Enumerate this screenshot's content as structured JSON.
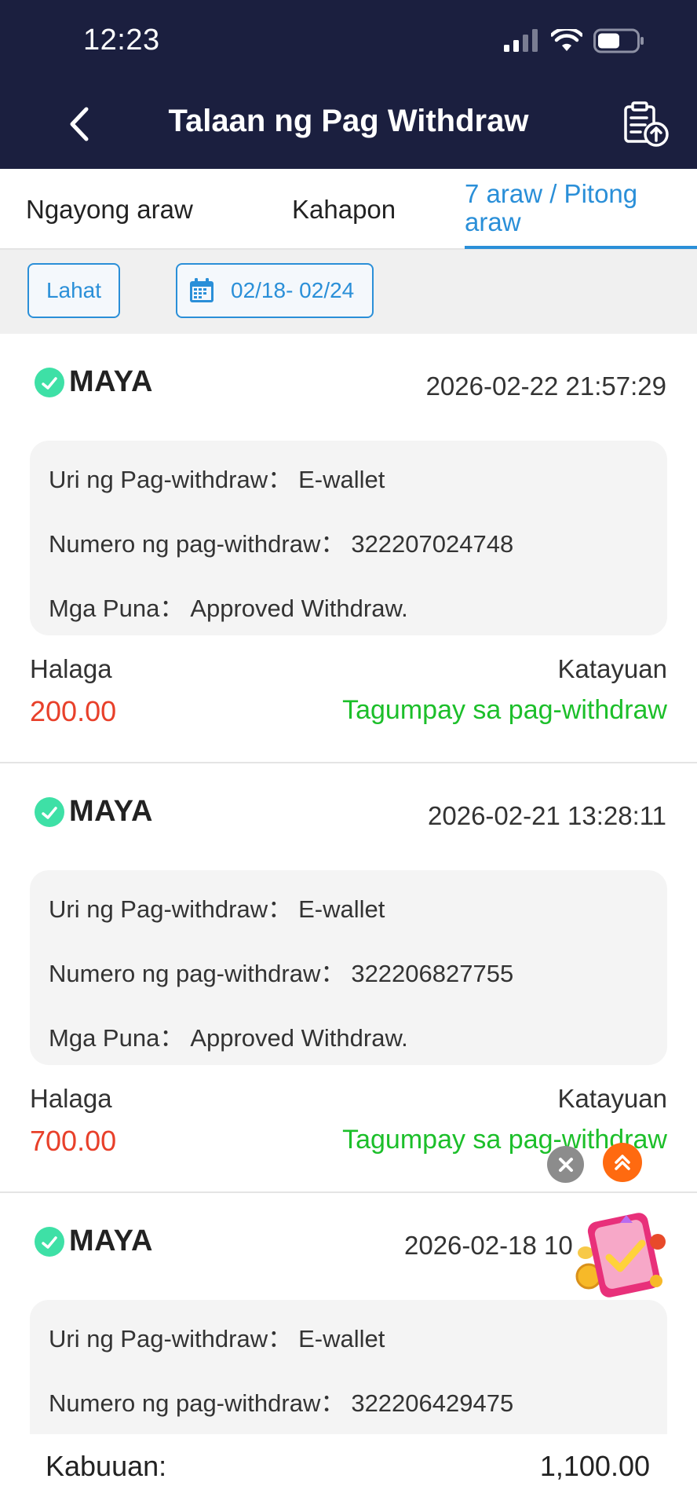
{
  "status_bar": {
    "time": "12:23"
  },
  "header": {
    "title": "Talaan ng Pag Withdraw"
  },
  "tabs": [
    {
      "label": "Ngayong araw",
      "active": false
    },
    {
      "label": "Kahapon",
      "active": false
    },
    {
      "label": "7 araw / Pitong araw",
      "active": true
    }
  ],
  "filters": {
    "all_label": "Lahat",
    "date_range": "02/18- 02/24"
  },
  "labels": {
    "type": "Uri ng Pag-withdraw：",
    "number": "Numero ng pag-withdraw：",
    "remarks": "Mga Puna：",
    "amount": "Halaga",
    "status": "Katayuan"
  },
  "records": [
    {
      "provider": "MAYA",
      "datetime": "2026-02-22 21:57:29",
      "type": "E-wallet",
      "number": "322207024748",
      "remarks": "Approved Withdraw.",
      "amount": "200.00",
      "status": "Tagumpay sa pag-withdraw"
    },
    {
      "provider": "MAYA",
      "datetime": "2026-02-21 13:28:11",
      "type": "E-wallet",
      "number": "322206827755",
      "remarks": "Approved Withdraw.",
      "amount": "700.00",
      "status": "Tagumpay sa pag-withdraw"
    },
    {
      "provider": "MAYA",
      "datetime": "2026-02-18 10",
      "type": "E-wallet",
      "number": "322206429475"
    }
  ],
  "footer": {
    "total_label": "Kabuuan:",
    "total_value": "1,100.00"
  },
  "colors": {
    "header_bg": "#1b1f3f",
    "accent": "#2a8fd8",
    "amount": "#e8402a",
    "success": "#1cbf2a",
    "maya_green": "#3ee0a6"
  }
}
